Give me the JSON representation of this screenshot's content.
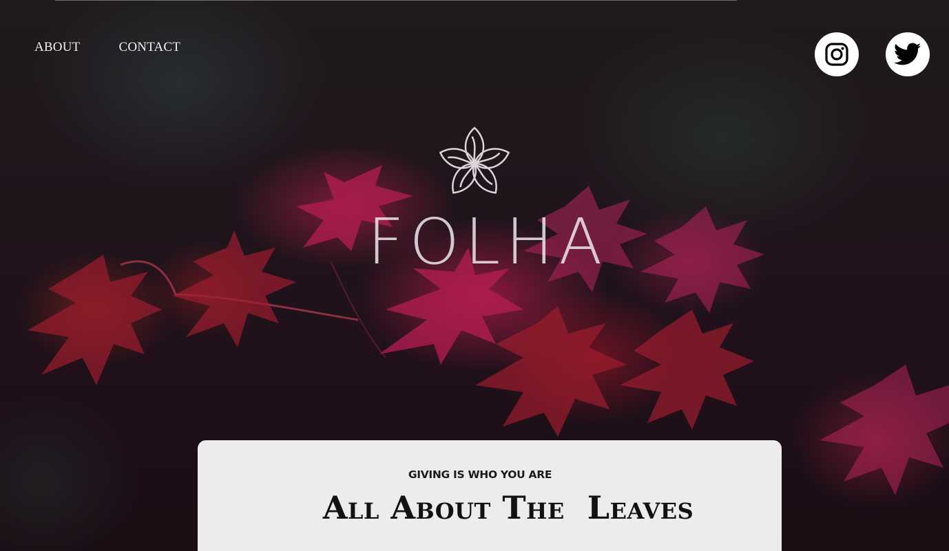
{
  "nav": {
    "items": [
      {
        "label": "ABOUT"
      },
      {
        "label": "CONTACT"
      }
    ]
  },
  "social": {
    "instagram_icon": "instagram-icon",
    "twitter_icon": "twitter-icon"
  },
  "brand": {
    "name": "FOLHA",
    "logo_icon": "flower-icon"
  },
  "feature": {
    "eyebrow": "GIVING IS WHO YOU ARE",
    "title": "All About The  Leaves"
  },
  "colors": {
    "background": "#1d1118",
    "leaf_accent": "#b01c48",
    "card": "#ececec",
    "text_light": "#f4f0f2",
    "text_dark": "#121212"
  }
}
